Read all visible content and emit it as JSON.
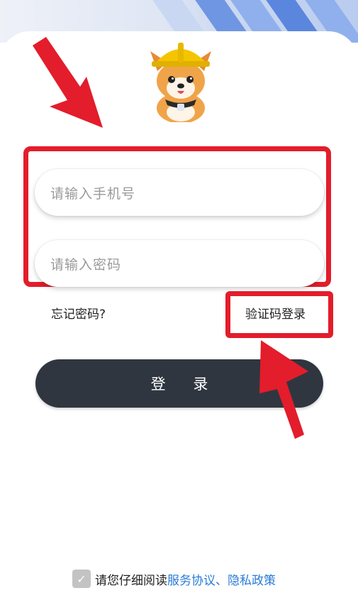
{
  "form": {
    "phone_placeholder": "请输入手机号",
    "password_placeholder": "请输入密码",
    "forgot_label": "忘记密码?",
    "sms_login_label": "验证码登录",
    "login_label": "登 录"
  },
  "agreement": {
    "check": "✓",
    "prefix": "请您仔细阅读",
    "links": "服务协议、隐私政策"
  },
  "colors": {
    "annotation_red": "#e31d2b",
    "login_button": "#2f3640",
    "link_blue": "#2a7bd6"
  }
}
